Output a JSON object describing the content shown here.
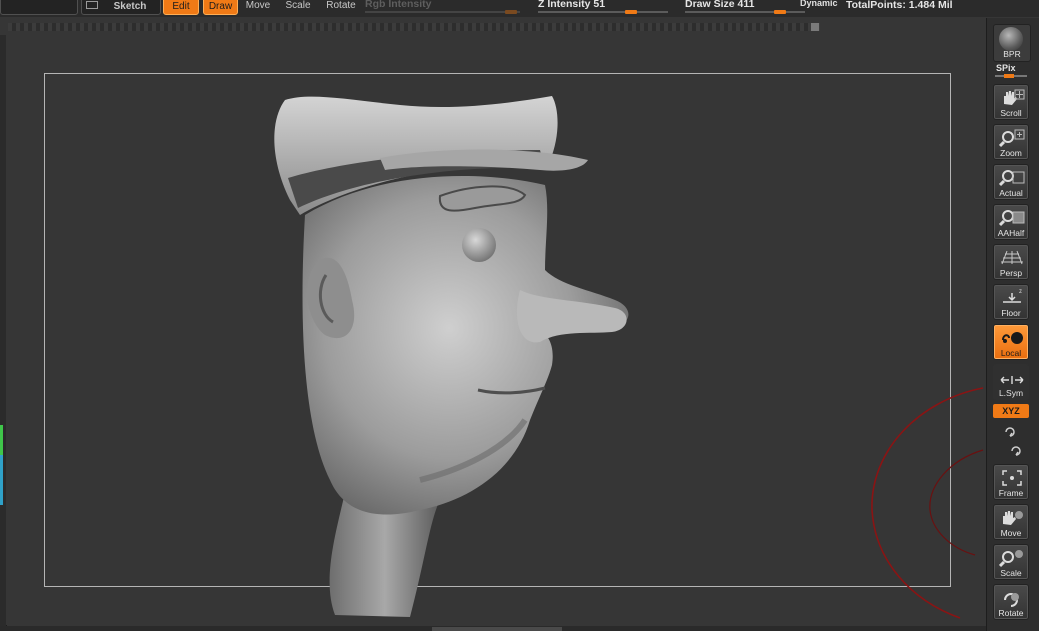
{
  "toolbar": {
    "sketch_label": "Sketch",
    "edit_label": "Edit",
    "draw_label": "Draw",
    "move_label": "Move",
    "scale_label": "Scale",
    "rotate_label": "Rotate",
    "rgb_intensity_label": "Rgb Intensity",
    "z_intensity_label": "Z Intensity 51",
    "draw_size_label": "Draw Size 411",
    "dynamic_label": "Dynamic",
    "total_points_label": "TotalPoints: 1.484 Mil"
  },
  "shelf": {
    "bpr_label": "BPR",
    "spix_label": "SPix",
    "scroll_label": "Scroll",
    "zoom_label": "Zoom",
    "actual_label": "Actual",
    "aahalf_label": "AAHalf",
    "persp_label": "Persp",
    "floor_label": "Floor",
    "local_label": "Local",
    "lsym_label": "L.Sym",
    "xyz_label": "XYZ",
    "frame_label": "Frame",
    "move_label": "Move",
    "scale_label": "Scale",
    "rotate_label": "Rotate"
  },
  "colors": {
    "accent": "#f07a16",
    "background": "#363636",
    "panel": "#2e2e2e"
  }
}
